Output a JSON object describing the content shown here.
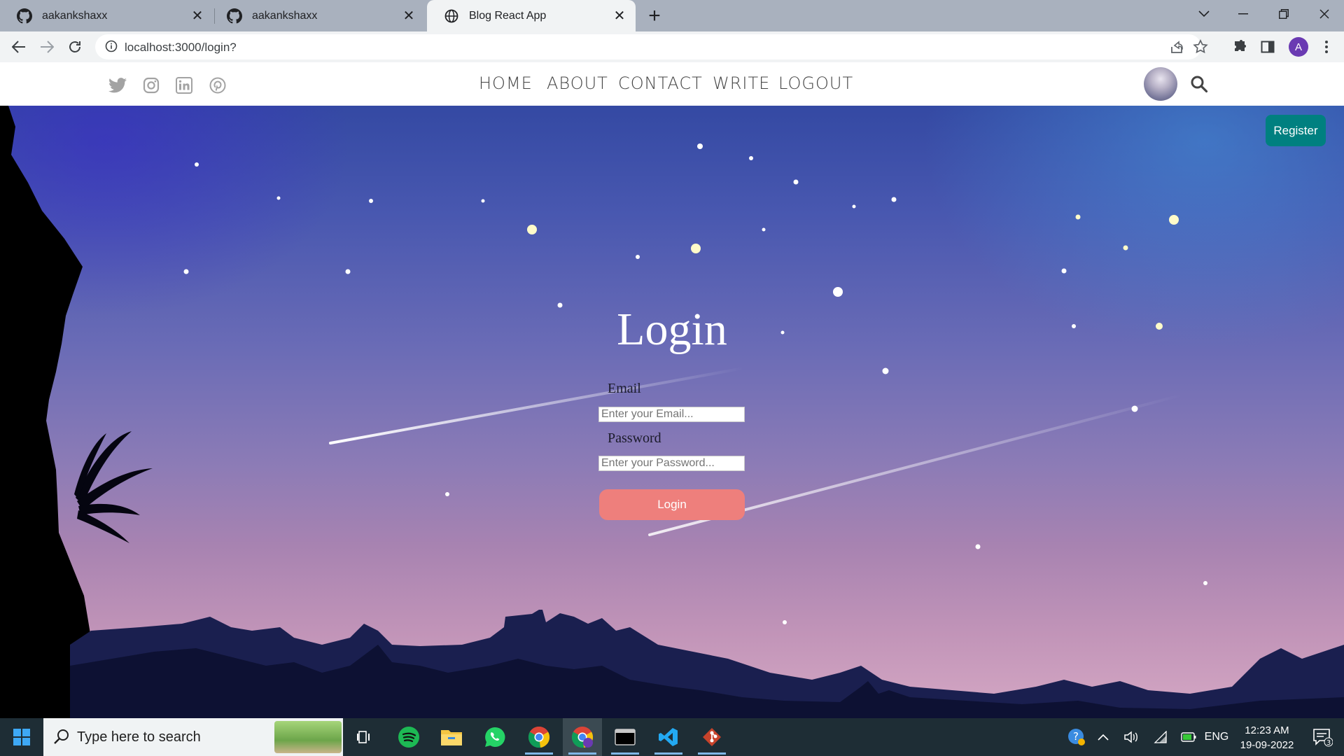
{
  "browser": {
    "tabs": [
      {
        "title": "aakankshaxx",
        "icon": "github-icon"
      },
      {
        "title": "aakankshaxx",
        "icon": "github-icon"
      },
      {
        "title": "Blog React App",
        "icon": "globe-icon",
        "active": true
      }
    ],
    "url": "localhost:3000/login?",
    "profile_initial": "A"
  },
  "site": {
    "social_icons": [
      "twitter-icon",
      "instagram-icon",
      "linkedin-icon",
      "pinterest-icon"
    ],
    "menu": [
      "HOME",
      "ABOUT",
      "CONTACT",
      "WRITE",
      "LOGOUT"
    ],
    "register_label": "Register"
  },
  "login": {
    "title": "Login",
    "email_label": "Email",
    "email_placeholder": "Enter your Email...",
    "password_label": "Password",
    "password_placeholder": "Enter your Password...",
    "button_label": "Login"
  },
  "taskbar": {
    "search_placeholder": "Type here to search",
    "language": "ENG",
    "time": "12:23 AM",
    "date": "19-09-2022",
    "notification_count": "3",
    "apps": [
      "task-view-icon",
      "spotify-icon",
      "file-explorer-icon",
      "whatsapp-icon",
      "chrome-icon",
      "chrome-profile-icon",
      "terminal-icon",
      "vscode-icon",
      "git-icon"
    ]
  },
  "colors": {
    "register_bg": "#008080",
    "login_button_bg": "#ee7f7c",
    "taskbar_bg": "#1e2d35"
  }
}
